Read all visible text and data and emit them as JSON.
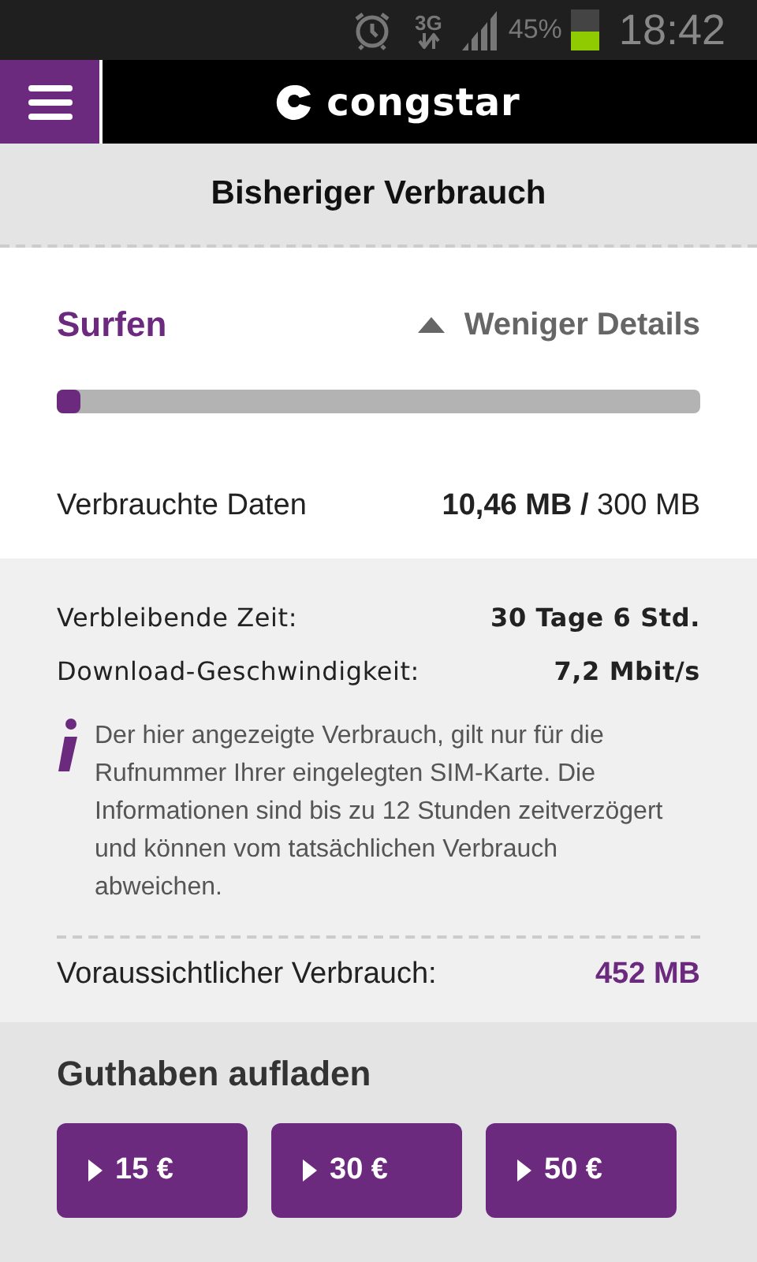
{
  "status_bar": {
    "network": "3G",
    "battery_text": "45%",
    "time": "18:42"
  },
  "header": {
    "logo_text": "congstar"
  },
  "page_title": "Bisheriger Verbrauch",
  "usage": {
    "title": "Surfen",
    "toggle_label": "Weniger Details",
    "expanded": true,
    "level": 0.035,
    "used_label": "Verbrauchte Daten",
    "used_value": "10,46 MB /",
    "total_value": "300 MB"
  },
  "details": {
    "rows": [
      {
        "label": "Verbleibende Zeit:",
        "value": "30 Tage 6 Std."
      },
      {
        "label": "Download-Geschwindigkeit:",
        "value": "7,2 Mbit/s"
      }
    ],
    "info": "Der hier angezeigte Verbrauch, gilt nur für die Rufnummer Ihrer eingelegten SIM-Karte. Die Informationen sind bis zu 12 Stunden zeitverzögert und können vom tatsächlichen Verbrauch abweichen.",
    "forecast_label": "Voraussichtlicher Verbrauch:",
    "forecast_value": "452 MB"
  },
  "topup": {
    "title": "Guthaben aufladen",
    "buttons": [
      "15 €",
      "30 €",
      "50 €"
    ]
  }
}
